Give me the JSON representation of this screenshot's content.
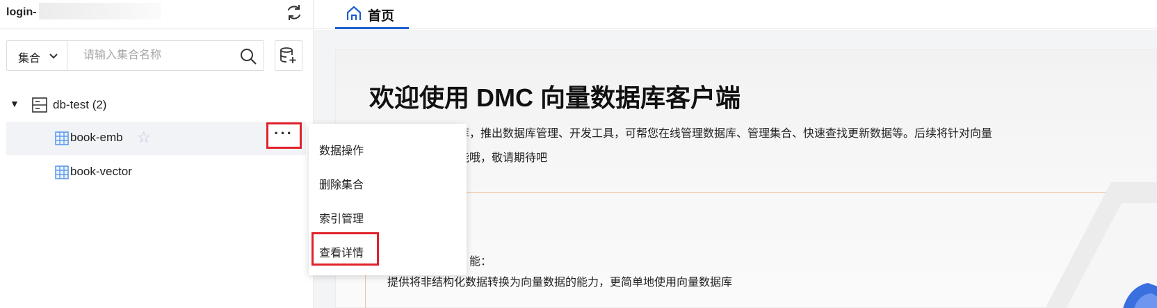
{
  "sidebar": {
    "login_label": "login-",
    "collection_select_label": "集合",
    "search_placeholder": "请输入集合名称",
    "database": {
      "arrow": "▼",
      "name": "db-test (2)"
    },
    "collections": [
      {
        "name": "book-emb",
        "selected": true
      },
      {
        "name": "book-vector",
        "selected": false
      }
    ],
    "more_label": "···",
    "star_icon": "☆"
  },
  "context_menu": {
    "items": [
      {
        "label": "数据操作"
      },
      {
        "label": "删除集合"
      },
      {
        "label": "索引管理"
      },
      {
        "label": "查看详情"
      }
    ]
  },
  "tabs": [
    {
      "label": "首页",
      "icon": "home-icon",
      "active": true
    }
  ],
  "welcome": {
    "title": "欢迎使用 DMC 向量数据库客户端",
    "desc_line1": "据库，推出数据库管理、开发工具，可帮您在线管理数据库、管理集合、快速查找更新数据等。后续将针对向量",
    "desc_line2": "功能哦，敬请期待吧",
    "feature_label": "能：",
    "feature_desc": "提供将非结构化数据转换为向量数据的能力，更简单地使用向量数据库"
  },
  "colors": {
    "accent": "#1a5ecf",
    "highlight_border": "#e0212b",
    "selected_row": "#f1f3f7",
    "table_icon": "#4a8fe8",
    "divider_orange": "#f0c59e"
  }
}
